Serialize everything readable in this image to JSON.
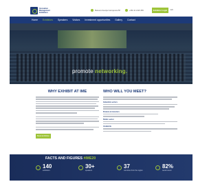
{
  "header": {
    "logo_lines": [
      "Innovative",
      "Management",
      "Exhibition"
    ],
    "contact_address": "Bulevar Arsenija Carnojevica 58",
    "contact_phone": "+381 11 2123 456",
    "cta_label": "Exhibitor Login",
    "lang": "EN"
  },
  "nav": {
    "items": [
      "Home",
      "Exhibitors",
      "Speakers",
      "Visitors",
      "Investment opportunities",
      "Gallery",
      "Contact"
    ],
    "active_index": 1
  },
  "hero": {
    "tagline_prefix": "promote ",
    "tagline_highlight": "networking."
  },
  "why_exhibit": {
    "title": "WHY EXHIBIT AT IME",
    "button_label": "Book Exhibition"
  },
  "who_meet": {
    "title": "WHO WILL YOU MEET?",
    "labels": [
      "Industrial sectors",
      "Finance & investors",
      "Public sector",
      "Academia"
    ]
  },
  "facts": {
    "title_prefix": "FACTS AND FIGURES ",
    "title_highlight": "#IME20",
    "stats": [
      {
        "value": "140",
        "label": "exhibitors"
      },
      {
        "value": "30+",
        "label": "speakers"
      },
      {
        "value": "37",
        "label": "countries from the region"
      },
      {
        "value": "82%",
        "label": "would return"
      }
    ]
  },
  "colors": {
    "brand_navy": "#1d3a78",
    "accent_green": "#9ec43a"
  }
}
